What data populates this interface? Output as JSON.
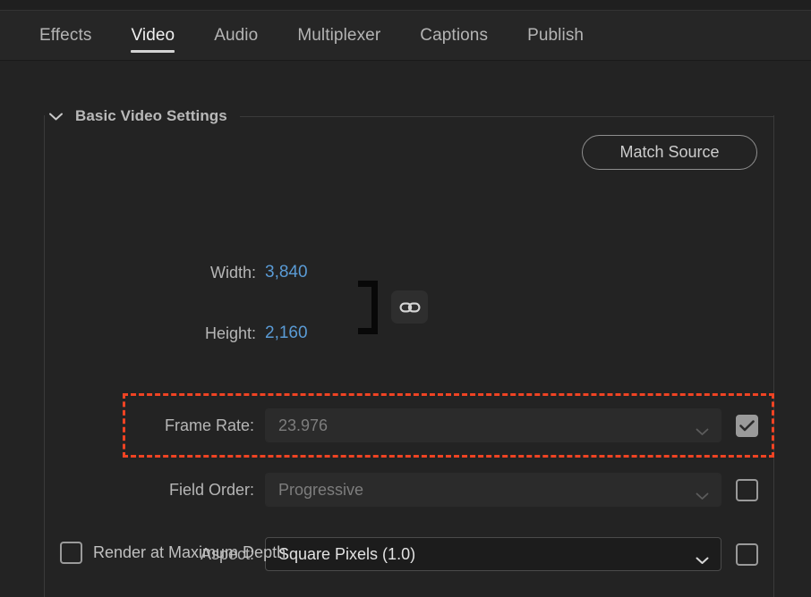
{
  "tabs": [
    {
      "label": "Effects",
      "active": false
    },
    {
      "label": "Video",
      "active": true
    },
    {
      "label": "Audio",
      "active": false
    },
    {
      "label": "Multiplexer",
      "active": false
    },
    {
      "label": "Captions",
      "active": false
    },
    {
      "label": "Publish",
      "active": false
    }
  ],
  "section": {
    "title": "Basic Video Settings",
    "collapse_icon": "chevron-down-icon",
    "match_source_label": "Match Source"
  },
  "dimensions": {
    "width_label": "Width:",
    "width_value": "3,840",
    "height_label": "Height:",
    "height_value": "2,160",
    "link_icon": "link-chain-icon",
    "link_state": "linked",
    "value_color": "#5a9bd5"
  },
  "fields": [
    {
      "label": "Frame Rate:",
      "value": "23.976",
      "disabled": true,
      "checkbox_checked": true,
      "caret_icon": "chevron-down-icon",
      "highlighted": true
    },
    {
      "label": "Field Order:",
      "value": "Progressive",
      "disabled": true,
      "checkbox_checked": false,
      "caret_icon": "chevron-down-icon",
      "highlighted": false
    },
    {
      "label": "Aspect:",
      "value": "Square Pixels (1.0)",
      "disabled": false,
      "checkbox_checked": false,
      "caret_icon": "chevron-down-icon",
      "highlighted": false
    }
  ],
  "render_depth": {
    "label": "Render at Maximum Depth",
    "checked": false
  },
  "annotation": {
    "color": "#ef4323",
    "style": "dashed-rectangle",
    "targets": "frame-rate-row"
  }
}
